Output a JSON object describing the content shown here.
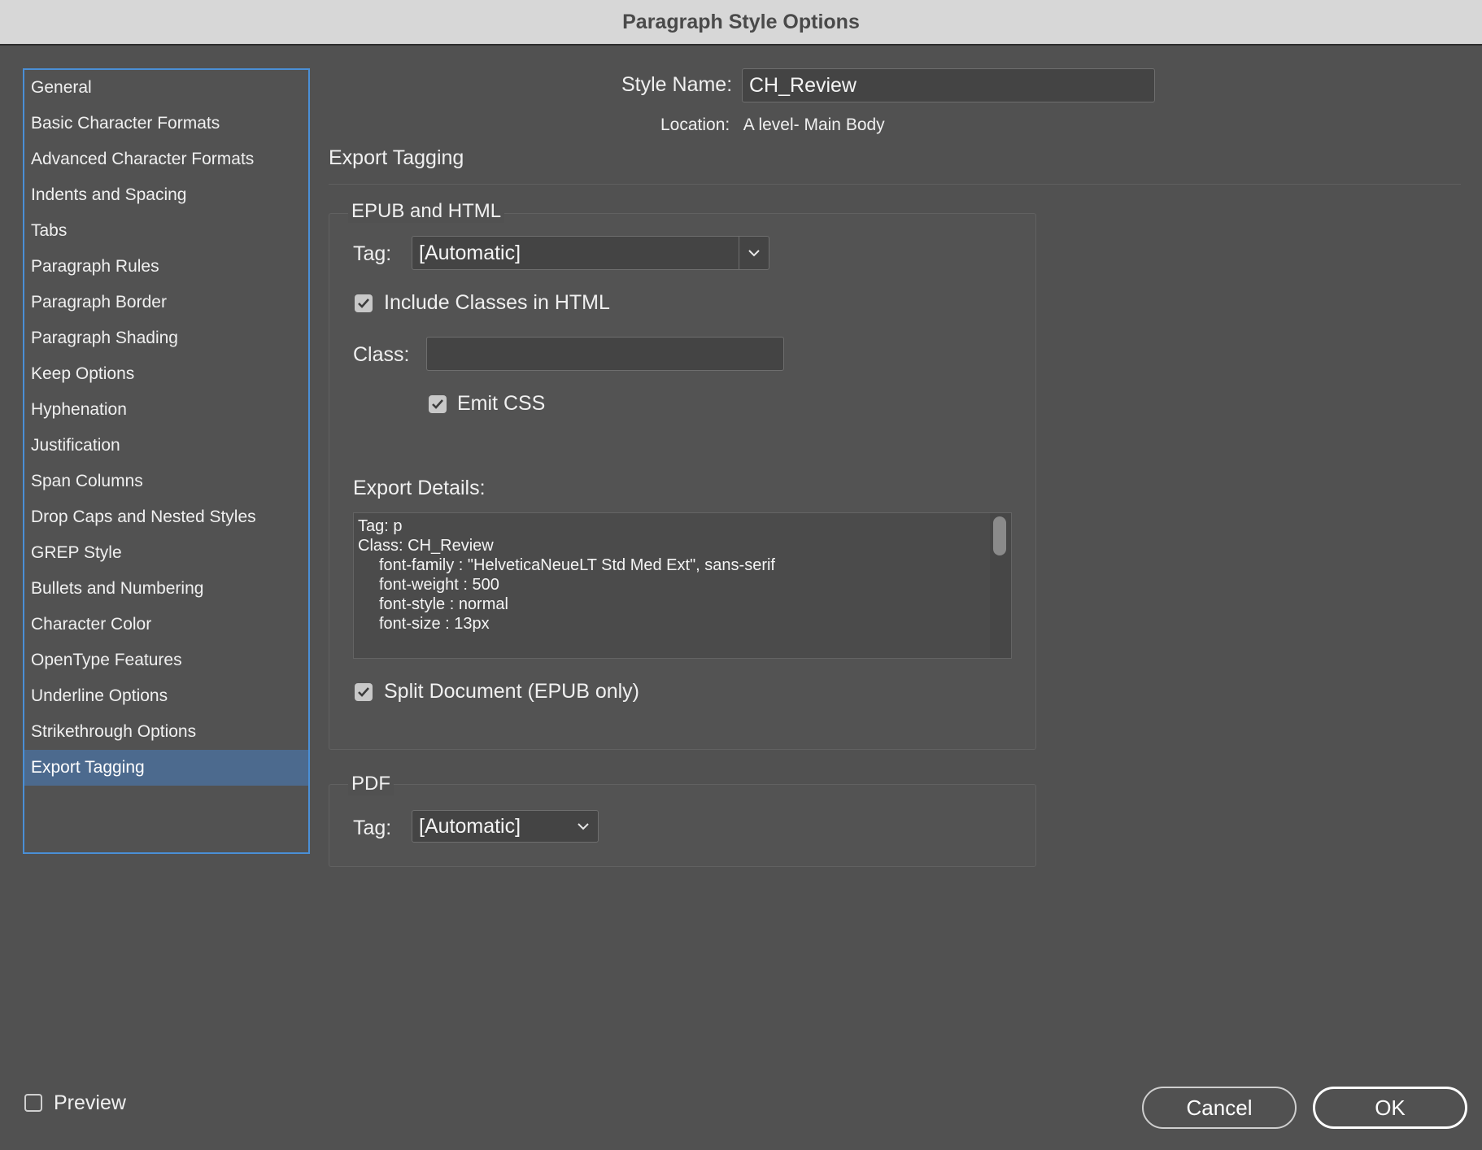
{
  "window": {
    "title": "Paragraph Style Options"
  },
  "sidebar": {
    "items": [
      {
        "label": "General"
      },
      {
        "label": "Basic Character Formats"
      },
      {
        "label": "Advanced Character Formats"
      },
      {
        "label": "Indents and Spacing"
      },
      {
        "label": "Tabs"
      },
      {
        "label": "Paragraph Rules"
      },
      {
        "label": "Paragraph Border"
      },
      {
        "label": "Paragraph Shading"
      },
      {
        "label": "Keep Options"
      },
      {
        "label": "Hyphenation"
      },
      {
        "label": "Justification"
      },
      {
        "label": "Span Columns"
      },
      {
        "label": "Drop Caps and Nested Styles"
      },
      {
        "label": "GREP Style"
      },
      {
        "label": "Bullets and Numbering"
      },
      {
        "label": "Character Color"
      },
      {
        "label": "OpenType Features"
      },
      {
        "label": "Underline Options"
      },
      {
        "label": "Strikethrough Options"
      },
      {
        "label": "Export Tagging"
      }
    ],
    "selected_label": "Export Tagging",
    "accent_color": "#4a8fd6",
    "selected_color": "#4c6a8e"
  },
  "header": {
    "style_name_label": "Style Name:",
    "style_name_value": "CH_Review",
    "location_label": "Location:",
    "location_value": "A level- Main Body"
  },
  "section": {
    "title": "Export Tagging"
  },
  "epub_html": {
    "group_title": "EPUB and HTML",
    "tag_label": "Tag:",
    "tag_value": "[Automatic]",
    "tag_icon": "chevron-down-icon",
    "include_classes_label": "Include Classes in HTML",
    "include_classes_checked": true,
    "class_label": "Class:",
    "class_value": "",
    "emit_css_label": "Emit CSS",
    "emit_css_checked": true,
    "export_details_label": "Export Details:",
    "export_details": {
      "line1": "Tag: p",
      "line2": "Class: CH_Review",
      "line3": "font-family : \"HelveticaNeueLT Std Med Ext\", sans-serif",
      "line4": "font-weight : 500",
      "line5": "font-style : normal",
      "line6": "font-size : 13px"
    },
    "split_document_label": "Split Document (EPUB only)",
    "split_document_checked": true
  },
  "pdf": {
    "group_title": "PDF",
    "tag_label": "Tag:",
    "tag_value": "[Automatic]",
    "tag_icon": "chevron-down-icon"
  },
  "footer": {
    "preview_label": "Preview",
    "preview_checked": false,
    "cancel_label": "Cancel",
    "ok_label": "OK"
  }
}
